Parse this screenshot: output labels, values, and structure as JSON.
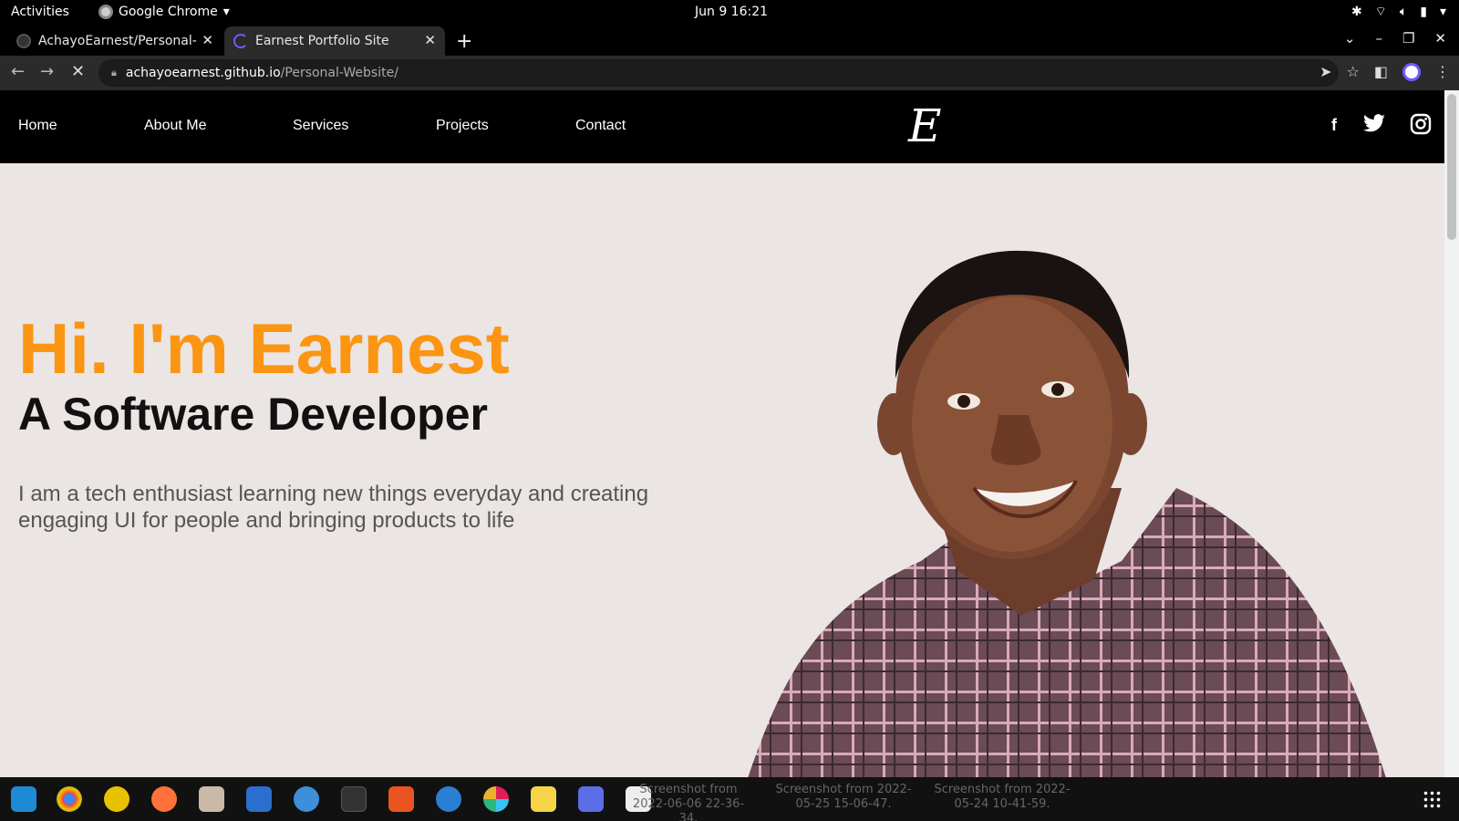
{
  "system_bar": {
    "activities": "Activities",
    "app_name": "Google Chrome",
    "clock": "Jun 9  16:21"
  },
  "tabs": [
    {
      "title": "AchayoEarnest/Personal-",
      "icon": "github-icon"
    },
    {
      "title": "Earnest Portfolio Site",
      "icon": "loading-spinner-icon"
    }
  ],
  "address_bar": {
    "host": "achayoearnest.github.io",
    "path": "/Personal-Website/"
  },
  "site": {
    "nav": [
      "Home",
      "About Me",
      "Services",
      "Projects",
      "Contact"
    ],
    "logo": "E",
    "social_icons": [
      "facebook-icon",
      "twitter-icon",
      "instagram-icon"
    ],
    "hero_title": "Hi. I'm Earnest",
    "hero_subtitle": "A Software Developer",
    "hero_text": "I am a tech enthusiast learning new things everyday and creating engaging UI for people and bringing products to life"
  },
  "dock": {
    "ghost_labels": [
      "Screenshot from 2022-06-06 22-36-34.",
      "Screenshot from 2022-05-25 15-06-47.",
      "Screenshot from 2022-05-24 10-41-59."
    ]
  },
  "colors": {
    "accent": "#fb9512",
    "page_bg": "#ebe5e4",
    "nav_bg": "#000000"
  }
}
